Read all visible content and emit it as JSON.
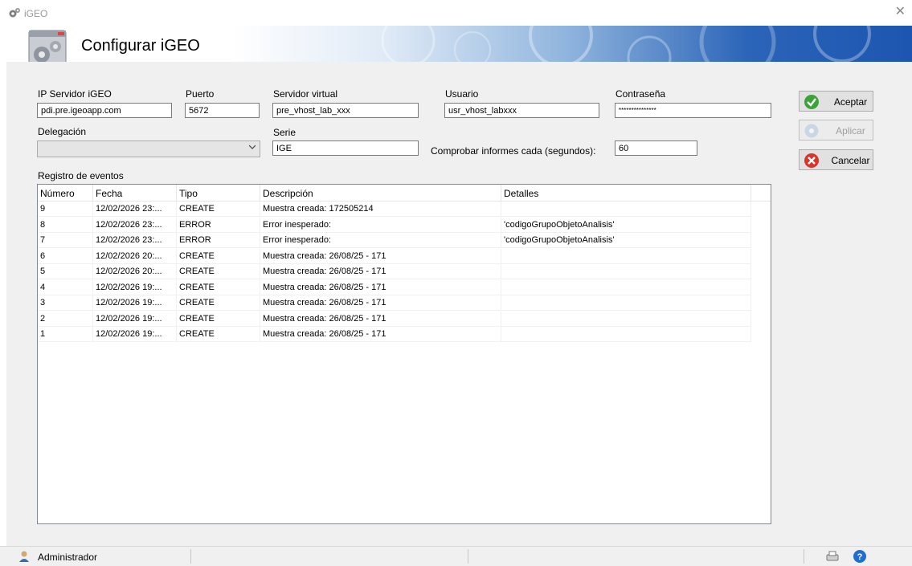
{
  "window": {
    "title": "iGEO"
  },
  "banner": {
    "title": "Configurar iGEO"
  },
  "form": {
    "ip_label": "IP Servidor iGEO",
    "ip_value": "pdi.pre.igeoapp.com",
    "port_label": "Puerto",
    "port_value": "5672",
    "vhost_label": "Servidor virtual",
    "vhost_value": "pre_vhost_lab_xxx",
    "user_label": "Usuario",
    "user_value": "usr_vhost_labxxx",
    "password_label": "Contraseña",
    "password_value": "***************",
    "delegation_label": "Delegación",
    "delegation_value": "",
    "series_label": "Serie",
    "series_value": "IGE",
    "check_label": "Comprobar informes cada (segundos):",
    "check_value": "60"
  },
  "buttons": {
    "accept": "Aceptar",
    "apply": "Aplicar",
    "cancel": "Cancelar"
  },
  "events": {
    "label": "Registro de eventos",
    "columns": [
      "Número",
      "Fecha",
      "Tipo",
      "Descripción",
      "Detalles"
    ],
    "rows": [
      {
        "num": "9",
        "fecha": "12/02/2026 23:...",
        "tipo": "CREATE",
        "desc": "Muestra creada: 172505214",
        "det": ""
      },
      {
        "num": "8",
        "fecha": "12/02/2026 23:...",
        "tipo": "ERROR",
        "desc": "Error inesperado:",
        "det": "'codigoGrupoObjetoAnalisis'"
      },
      {
        "num": "7",
        "fecha": "12/02/2026 23:...",
        "tipo": "ERROR",
        "desc": "Error inesperado:",
        "det": "'codigoGrupoObjetoAnalisis'"
      },
      {
        "num": "6",
        "fecha": "12/02/2026 20:...",
        "tipo": "CREATE",
        "desc": "Muestra creada: 26/08/25 - 171",
        "det": ""
      },
      {
        "num": "5",
        "fecha": "12/02/2026 20:...",
        "tipo": "CREATE",
        "desc": "Muestra creada: 26/08/25 - 171",
        "det": ""
      },
      {
        "num": "4",
        "fecha": "12/02/2026 19:...",
        "tipo": "CREATE",
        "desc": "Muestra creada: 26/08/25 - 171",
        "det": ""
      },
      {
        "num": "3",
        "fecha": "12/02/2026 19:...",
        "tipo": "CREATE",
        "desc": "Muestra creada: 26/08/25 - 171",
        "det": ""
      },
      {
        "num": "2",
        "fecha": "12/02/2026 19:...",
        "tipo": "CREATE",
        "desc": "Muestra creada: 26/08/25 - 171",
        "det": ""
      },
      {
        "num": "1",
        "fecha": "12/02/2026 19:...",
        "tipo": "CREATE",
        "desc": "Muestra creada: 26/08/25 - 171",
        "det": ""
      }
    ]
  },
  "status": {
    "user": "Administrador"
  },
  "icons": {
    "app": "gears-icon",
    "close": "close-icon",
    "logo": "gears-window-icon",
    "accept": "check-icon",
    "apply": "disc-icon",
    "cancel": "cancel-icon",
    "user": "user-icon",
    "printer": "printer-icon",
    "help": "help-icon"
  },
  "colors": {
    "accept_green": "#3ea23a",
    "cancel_red": "#d9362b",
    "help_blue": "#1e6fd0",
    "banner_blue": "#1c56b0"
  }
}
